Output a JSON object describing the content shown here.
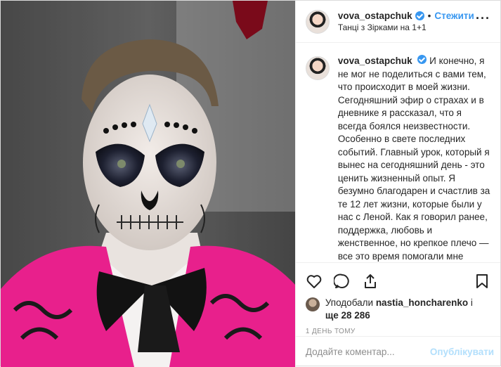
{
  "post": {
    "username": "vova_ostapchuk",
    "follow_label": "Стежити",
    "separator": "•",
    "location": "Танці з Зірками на 1+1",
    "more_icon": "more-icon"
  },
  "caption": {
    "username": "vova_ostapchuk",
    "text": "И конечно, я не мог не поделиться с вами тем, что происходит в моей жизни. Сегодняшний эфир о страхах и в дневнике я рассказал, что я всегда боялся неизвестности. Особенно в свете последних событий. Главный урок, который я вынес на сегодняшний день - это ценить жизненный опыт. Я безумно благодарен и счастлив за те 12 лет жизни, которые были у нас с Леной. Как я говорил ранее, поддержка, любовь и женственное, но крепкое плечо — все это время помогали мне уверенно идти вперед, а дети всегда были стимулом. Спасибо за"
  },
  "actions": {
    "like_icon": "heart-icon",
    "comment_icon": "comment-icon",
    "share_icon": "share-icon",
    "save_icon": "bookmark-icon"
  },
  "likes": {
    "prefix": "Уподобали",
    "user": "nastia_honcharenko",
    "conj": "і",
    "more": "ще 28 286"
  },
  "timestamp": "1 ДЕНЬ ТОМУ",
  "comment_box": {
    "placeholder": "Додайте коментар...",
    "publish_label": "Опублікувати"
  },
  "colors": {
    "accent": "#3897f0",
    "publish_disabled": "#b2dffc",
    "jacket": "#e8208c"
  }
}
